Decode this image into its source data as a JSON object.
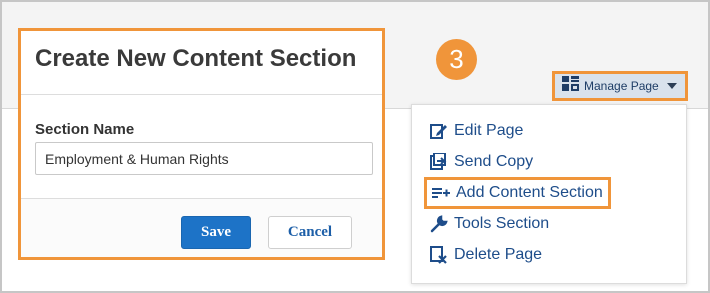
{
  "dialog": {
    "title": "Create New Content Section",
    "section_name_label": "Section Name",
    "section_name_value": "Employment & Human Rights",
    "save_label": "Save",
    "cancel_label": "Cancel"
  },
  "step": {
    "number": "3"
  },
  "manage_page": {
    "label": "Manage Page"
  },
  "menu": {
    "items": [
      {
        "label": "Edit Page",
        "icon": "edit-page-icon"
      },
      {
        "label": "Send Copy",
        "icon": "send-copy-icon"
      },
      {
        "label": "Add Content Section",
        "icon": "add-section-icon"
      },
      {
        "label": "Tools Section",
        "icon": "wrench-icon"
      },
      {
        "label": "Delete Page",
        "icon": "delete-page-icon"
      }
    ]
  },
  "colors": {
    "highlight": "#f0953a",
    "primary": "#1d73c7",
    "link": "#1e4d8a"
  }
}
